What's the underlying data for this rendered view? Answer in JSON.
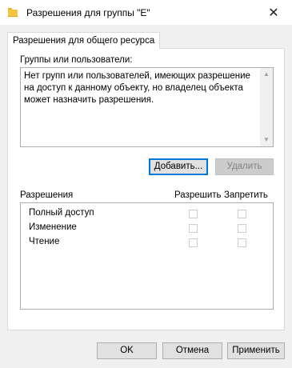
{
  "window": {
    "title": "Разрешения для группы \"E\"",
    "close_label": "✕"
  },
  "tab": {
    "label": "Разрешения для общего ресурса"
  },
  "users": {
    "label": "Группы или пользователи:",
    "message": "Нет групп или пользователей, имеющих разрешение на доступ к данному объекту, но владелец объекта может назначить разрешения."
  },
  "buttons": {
    "add": "Добавить...",
    "remove": "Удалить"
  },
  "permissions": {
    "header": "Разрешения",
    "allow_header": "Разрешить",
    "deny_header": "Запретить",
    "rows": [
      {
        "name": "Полный доступ",
        "allow": false,
        "deny": false
      },
      {
        "name": "Изменение",
        "allow": false,
        "deny": false
      },
      {
        "name": "Чтение",
        "allow": false,
        "deny": false
      }
    ]
  },
  "footer": {
    "ok": "OK",
    "cancel": "Отмена",
    "apply": "Применить"
  }
}
